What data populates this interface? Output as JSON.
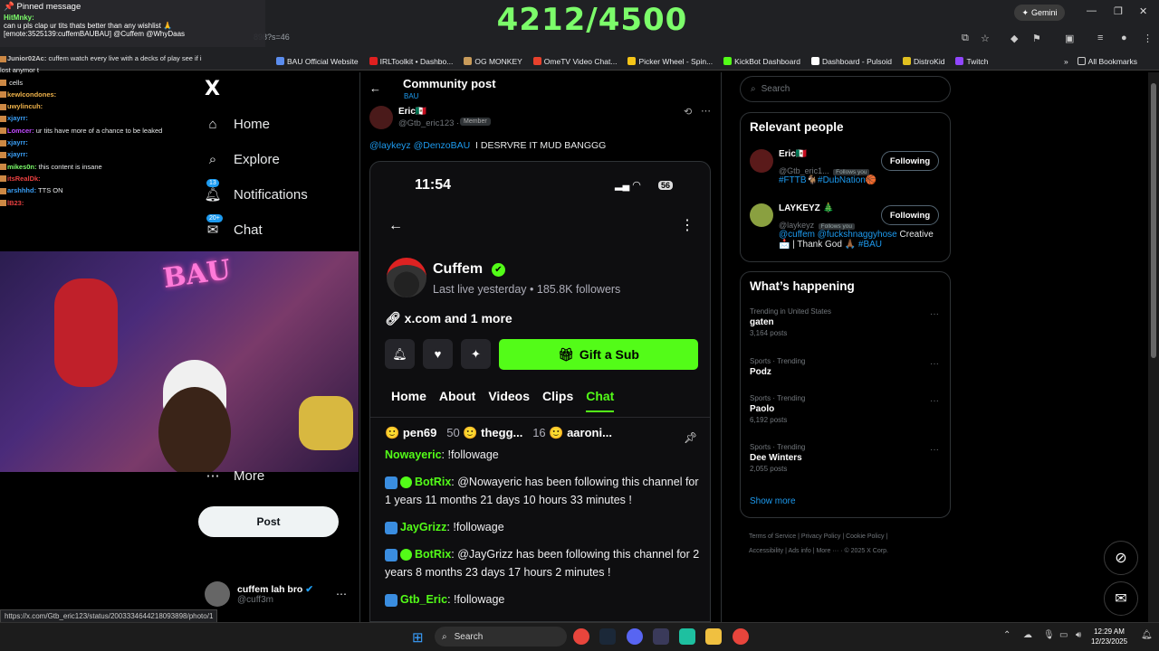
{
  "counter": "4212/4500",
  "browser": {
    "url": "898?s=46",
    "gemini_label": "Gemini",
    "bookmarks": [
      {
        "label": "BAU Official Website",
        "color": "#5b8def"
      },
      {
        "label": "IRLToolkit • Dashbo...",
        "color": "#e02020"
      },
      {
        "label": "OG MONKEY",
        "color": "#c89b5a"
      },
      {
        "label": "OmeTV Video Chat...",
        "color": "#e8412c"
      },
      {
        "label": "Picker Wheel - Spin...",
        "color": "#f5c518"
      },
      {
        "label": "KickBot Dashboard",
        "color": "#53fc18"
      },
      {
        "label": "Dashboard - Pulsoid",
        "color": "#ffffff"
      },
      {
        "label": "DistroKid",
        "color": "#e0c020"
      },
      {
        "label": "Twitch",
        "color": "#9146ff"
      }
    ],
    "all_bookmarks": "All Bookmarks",
    "bm_more": "»"
  },
  "pinned": {
    "header": "Pinned message",
    "user": "HitMnky:",
    "text": "can u pls clap ur tits thats better than any wishlist 🙏 [emote:3525139:cuffemBAUBAU] @Cuffem @WhyDaas"
  },
  "stream_chat": [
    {
      "user": "Junior02Ac:",
      "text": "cuffem watch every live with a decks of play see if i lost anymor t",
      "color": "#cccccc"
    },
    {
      "user": "",
      "text": "cells",
      "color": "#cccccc"
    },
    {
      "user": "kewlcondones:",
      "text": "",
      "color": "#f0b34a"
    },
    {
      "user": "uwylincuh:",
      "text": "",
      "color": "#f0b34a"
    },
    {
      "user": "xjayrr:",
      "text": "",
      "color": "#3a9ef5"
    },
    {
      "user": "Lomcer:",
      "text": "ur tits have more of a chance to be leaked",
      "color": "#c04aff"
    },
    {
      "user": "xjayrr:",
      "text": "",
      "color": "#3a9ef5"
    },
    {
      "user": "xjayrr:",
      "text": "",
      "color": "#3a9ef5"
    },
    {
      "user": "mikes0n:",
      "text": "this content is insane",
      "color": "#7CFC6A"
    },
    {
      "user": "itsRealDk:",
      "text": "",
      "color": "#e84040"
    },
    {
      "user": "arshhhd:",
      "text": "TTS ON",
      "color": "#3a9ef5"
    },
    {
      "user": "lB23:",
      "text": "",
      "color": "#e84040"
    }
  ],
  "xnav": {
    "logo": "X",
    "home": "Home",
    "explore": "Explore",
    "notifications": "Notifications",
    "notif_badge": "13",
    "chat": "Chat",
    "chat_badge": "20+",
    "more": "More",
    "post": "Post",
    "account_name": "cuffem lah bro",
    "account_handle": "@cuff3m"
  },
  "post": {
    "page_title": "Community post",
    "community": "BAU",
    "author": "Eric🇲🇽",
    "handle": "@Gtb_eric123",
    "separator": "·",
    "member_label": "Member",
    "mentions": "@laykeyz @DenzoBAU",
    "text": "I DESRVRE IT MUD BANGGG"
  },
  "phone": {
    "time": "11:54",
    "battery": "56",
    "channel": "Cuffem",
    "last_live": "Last live yesterday",
    "followers": "185.8K followers",
    "dot": "•",
    "link": "x.com and 1 more",
    "gift": "Gift a Sub",
    "tabs": [
      "Home",
      "About",
      "Videos",
      "Clips",
      "Chat"
    ],
    "top_bar": "pen69",
    "top_bar_2": "50",
    "top_bar_3": "thegg...",
    "top_bar_4": "16",
    "top_bar_5": "aaroni...",
    "messages": [
      {
        "user": "Nowayeric",
        "text": ": !followage"
      },
      {
        "user": "BotRix",
        "text": ": @Nowayeric has been following this channel for 1 years 11 months 21 days 10 hours 33 minutes !"
      },
      {
        "user": "JayGrizz",
        "text": ": !followage"
      },
      {
        "user": "BotRix",
        "text": ": @JayGrizz has been following this channel for 2 years 8 months 23 days 17 hours 2 minutes !"
      },
      {
        "user": "Gtb_Eric",
        "text": ": !followage"
      }
    ]
  },
  "right": {
    "search_placeholder": "Search",
    "relevant_title": "Relevant people",
    "people": [
      {
        "name": "Eric🇲🇽",
        "handle": "@Gtb_eric1...",
        "follows_you": "Follows you",
        "bio_tags": "#FTTB",
        "bio_mid": "🐐",
        "bio_tag2": "#DubNation",
        "bio_end": "🏀",
        "button": "Following"
      },
      {
        "name": "LAYKEYZ 🎄",
        "handle": "@laykeyz",
        "follows_you": "Follows you",
        "bio_tags": "@cuffem @fuckshnaggyhose",
        "bio_mid": " Creative 📩 | Thank God 🙏🏾 ",
        "bio_tag2": "#BAU",
        "bio_end": "",
        "button": "Following"
      }
    ],
    "happening_title": "What’s happening",
    "trends": [
      {
        "context": "Trending in United States",
        "name": "gaten",
        "count": "3,164 posts"
      },
      {
        "context": "Sports · Trending",
        "name": "Podz",
        "count": ""
      },
      {
        "context": "Sports · Trending",
        "name": "Paolo",
        "count": "6,192 posts"
      },
      {
        "context": "Sports · Trending",
        "name": "Dee Winters",
        "count": "2,055 posts"
      }
    ],
    "show_more": "Show more",
    "footer_1": "Terms of Service  |  Privacy Policy  |  Cookie Policy  |",
    "footer_2": "Accessibility  |  Ads info  |  More ···  ·  © 2025 X Corp."
  },
  "status_url": "https://x.com/Gtb_eric123/status/2003334644218093898/photo/1",
  "taskbar": {
    "search": "Search",
    "time": "12:29 AM",
    "date": "12/23/2025"
  }
}
